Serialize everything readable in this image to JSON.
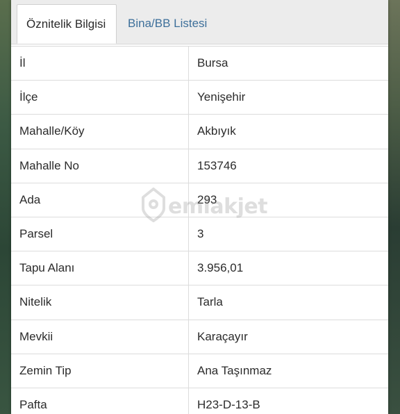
{
  "tabs": [
    {
      "label": "Öznitelik Bilgisi",
      "active": true
    },
    {
      "label": "Bina/BB Listesi",
      "active": false
    }
  ],
  "rows": [
    {
      "label": "İl",
      "value": "Bursa"
    },
    {
      "label": "İlçe",
      "value": "Yenişehir"
    },
    {
      "label": "Mahalle/Köy",
      "value": "Akbıyık"
    },
    {
      "label": "Mahalle No",
      "value": "153746"
    },
    {
      "label": "Ada",
      "value": "293"
    },
    {
      "label": "Parsel",
      "value": "3"
    },
    {
      "label": "Tapu Alanı",
      "value": "3.956,01"
    },
    {
      "label": "Nitelik",
      "value": "Tarla"
    },
    {
      "label": "Mevkii",
      "value": "Karaçayır"
    },
    {
      "label": "Zemin Tip",
      "value": "Ana Taşınmaz"
    },
    {
      "label": "Pafta",
      "value": "H23-D-13-B"
    }
  ],
  "watermark": {
    "text": "emlakjet",
    "icon": "home-pin-icon"
  },
  "colors": {
    "active_tab_text": "#2a2a2a",
    "inactive_tab_text": "#3d6f9a",
    "border": "#dcdcdc",
    "panel_bg": "#ffffff"
  }
}
